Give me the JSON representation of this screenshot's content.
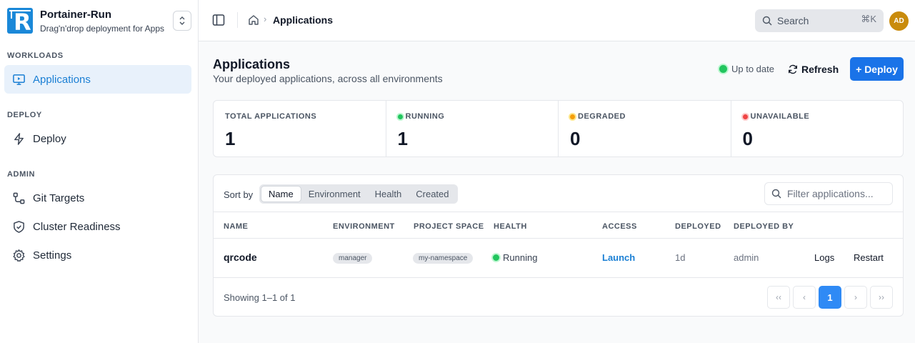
{
  "brand": {
    "title": "Portainer-Run",
    "subtitle": "Drag'n'drop deployment for Apps"
  },
  "sidebar": {
    "sections": [
      {
        "label": "WORKLOADS",
        "items": [
          {
            "label": "Applications",
            "icon": "monitor-play-icon",
            "active": true
          }
        ]
      },
      {
        "label": "DEPLOY",
        "items": [
          {
            "label": "Deploy",
            "icon": "lightning-icon"
          }
        ]
      },
      {
        "label": "ADMIN",
        "items": [
          {
            "label": "Git Targets",
            "icon": "git-branch-icon"
          },
          {
            "label": "Cluster Readiness",
            "icon": "shield-check-icon"
          },
          {
            "label": "Settings",
            "icon": "gear-icon"
          }
        ]
      }
    ]
  },
  "topbar": {
    "breadcrumb_current": "Applications",
    "search_placeholder": "Search",
    "search_shortcut": "⌘K",
    "avatar_initials": "AD"
  },
  "page": {
    "title": "Applications",
    "subtitle": "Your deployed applications, across all environments",
    "status": "Up to date",
    "refresh_label": "Refresh",
    "deploy_label": "+ Deploy"
  },
  "stats": [
    {
      "label": "TOTAL APPLICATIONS",
      "value": "1"
    },
    {
      "label": "RUNNING",
      "value": "1",
      "color": "#22c55e"
    },
    {
      "label": "DEGRADED",
      "value": "0",
      "color": "#f59e0b"
    },
    {
      "label": "UNAVAILABLE",
      "value": "0",
      "color": "#ef4444"
    }
  ],
  "sort": {
    "label": "Sort by",
    "options": [
      "Name",
      "Environment",
      "Health",
      "Created"
    ],
    "selected": "Name"
  },
  "filter_placeholder": "Filter applications...",
  "table": {
    "columns": [
      "NAME",
      "ENVIRONMENT",
      "PROJECT SPACE",
      "HEALTH",
      "ACCESS",
      "DEPLOYED",
      "DEPLOYED BY"
    ],
    "rows": [
      {
        "name": "qrcode",
        "environment": "manager",
        "project_space": "my-namespace",
        "health": "Running",
        "access": "Launch",
        "deployed": "1d",
        "deployed_by": "admin",
        "actions": [
          "Logs",
          "Restart"
        ]
      }
    ]
  },
  "pagination": {
    "showing": "Showing 1–1 of 1",
    "first": "‹‹",
    "prev": "‹",
    "current": "1",
    "next": "›",
    "last": "››"
  },
  "colors": {
    "accent": "#1a73e8",
    "active_nav_bg": "#e8f1fb",
    "avatar": "#c98b0c"
  }
}
